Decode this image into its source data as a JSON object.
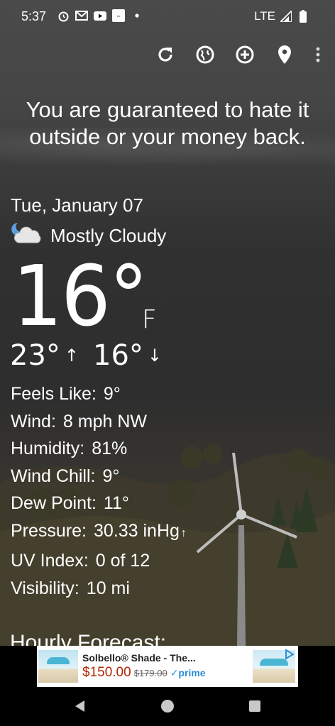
{
  "status": {
    "time": "5:37",
    "network": "LTE"
  },
  "toolbar": {
    "refresh_icon": "refresh-icon",
    "radar_icon": "radar-icon",
    "add_icon": "add-location-icon",
    "location_icon": "location-pin-icon",
    "more_icon": "more-vertical-icon"
  },
  "snark": "You are guaranteed to hate it outside or your money back.",
  "date": "Tue, January 07",
  "condition": "Mostly Cloudy",
  "temperature": "16°",
  "unit": "F",
  "high": "23°",
  "low": "16°",
  "details": [
    {
      "label": "Feels Like:",
      "value": "9°"
    },
    {
      "label": "Wind:",
      "value": "8 mph NW"
    },
    {
      "label": "Humidity:",
      "value": "81%"
    },
    {
      "label": "Wind Chill:",
      "value": "9°"
    },
    {
      "label": "Dew Point:",
      "value": "11°"
    },
    {
      "label": "Pressure:",
      "value": "30.33 inHg"
    },
    {
      "label": "UV Index:",
      "value": "0 of 12"
    },
    {
      "label": "Visibility:",
      "value": "10 mi"
    }
  ],
  "hourly_title": "Hourly Forecast:",
  "ad": {
    "title": "Solbello® Shade - The...",
    "price": "$150.00",
    "old_price": "$179.00",
    "prime": "prime"
  },
  "colors": {
    "background": "#2e2e2e",
    "text": "#ffffff",
    "ad_price": "#b12704",
    "prime": "#2a8fd6"
  }
}
